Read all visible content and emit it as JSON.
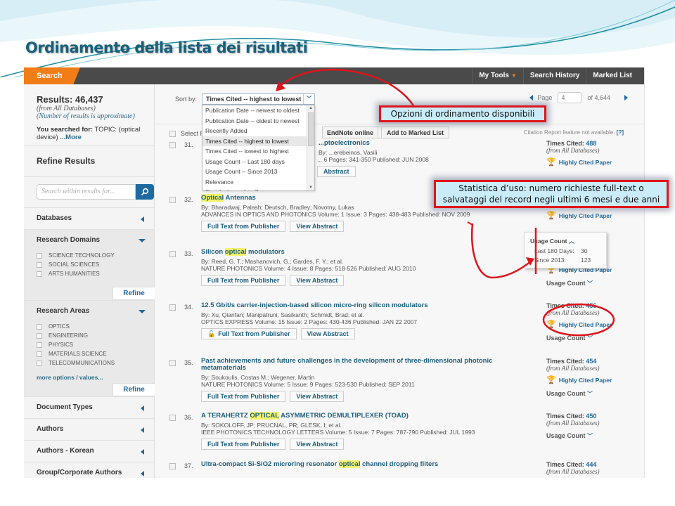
{
  "slide": {
    "title": "Ordinamento della lista dei risultati"
  },
  "colors": {
    "accent_orange": "#f07d17",
    "link_blue": "#1b5e7e",
    "topbar": "#4a4a4a",
    "annotation_red": "#e0141b",
    "callout_bg": "#c9ecf8"
  },
  "topbar": {
    "search_tab": "Search",
    "nav": [
      "My Tools",
      "Search History",
      "Marked List"
    ]
  },
  "left": {
    "results_label": "Results: 46,437",
    "from_db": "(from All Databases)",
    "approx_note": "(Number of results is approximate)",
    "searched_prefix": "You searched for:",
    "searched_query": "TOPIC: (optical device)",
    "more": "...More",
    "refine_title": "Refine Results",
    "search_within_placeholder": "Search within results for...",
    "refine_label": "Refine",
    "more_options": "more options / values...",
    "facets": {
      "databases": "Databases",
      "research_domains": {
        "label": "Research Domains",
        "options": [
          "SCIENCE TECHNOLOGY",
          "SOCIAL SCIENCES",
          "ARTS HUMANITIES"
        ]
      },
      "research_areas": {
        "label": "Research Areas",
        "options": [
          "OPTICS",
          "ENGINEERING",
          "PHYSICS",
          "MATERIALS SCIENCE",
          "TELECOMMUNICATIONS"
        ]
      },
      "document_types": "Document Types",
      "authors": "Authors",
      "authors_korean": "Authors - Korean",
      "group_authors": "Group/Corporate Authors"
    }
  },
  "sort": {
    "label": "Sort by:",
    "selected": "Times Cited -- highest to lowest",
    "options": [
      "Publication Date -- newest to oldest",
      "Publication Date -- oldest to newest",
      "Recently Added",
      "Times Cited -- highest to lowest",
      "Times Cited -- lowest to highest",
      "Usage Count -- Last 180 days",
      "Usage Count -- Since 2013",
      "Relevance",
      "First Author -- A to Z"
    ]
  },
  "pager": {
    "page_label": "Page",
    "current_page": "4",
    "of_label": "of",
    "total_pages": "4,644"
  },
  "toolbar": {
    "select_page": "Select Page",
    "endnote": "EndNote online",
    "add_marked": "Add to Marked List",
    "citation_note": "Citation Report feature not available.",
    "help": "[?]"
  },
  "buttons": {
    "full_text": "Full Text from Publisher",
    "view_abstract": "View Abstract"
  },
  "side_labels": {
    "times_cited": "Times Cited:",
    "from_db": "(from All Databases)",
    "highly_cited": "Highly Cited Paper",
    "usage_count": "Usage Count"
  },
  "usage_popup": {
    "title": "Usage Count",
    "rows": [
      {
        "label": "Last 180 Days:",
        "value": "30"
      },
      {
        "label": "Since 2013:",
        "value": "123"
      }
    ]
  },
  "records": [
    {
      "num": "31.",
      "title_pre": "",
      "title_hl": "",
      "title_post": "...ptoelectronics",
      "authors": "By: ...erebeinos, Vasili",
      "source": "... 6   Pages: 341-350   Published: JUN 2008",
      "times_cited": "488",
      "highly_cited": true
    },
    {
      "num": "32.",
      "title_pre": "",
      "title_hl": "Optical",
      "title_post": " Antennas",
      "authors": "By: Bharadwaj, Palash; Deutsch, Bradley; Novotny, Lukas",
      "source": "ADVANCES IN OPTICS AND PHOTONICS  Volume: 1   Issue: 3   Pages: 438-483   Published: NOV 2009",
      "times_cited": "",
      "highly_cited": true
    },
    {
      "num": "33.",
      "title_pre": "Silicon ",
      "title_hl": "optical",
      "title_post": " modulators",
      "authors": "By: Reed, G. T.; Mashanovich, G.; Gardes, F. Y.; et al.",
      "source": "NATURE PHOTONICS  Volume: 4   Issue: 8   Pages: 518-526   Published: AUG 2010",
      "times_cited": "",
      "highly_cited": true
    },
    {
      "num": "34.",
      "title_pre": "12.5 Gbit/s carrier-injection-based silicon micro-ring silicon modulators",
      "title_hl": "",
      "title_post": "",
      "authors": "By: Xu, Qianfan; Manipatruni, Sasikanth; Schmidt, Brad; et al.",
      "source": "OPTICS EXPRESS  Volume: 15   Issue: 2   Pages: 430-436   Published: JAN 22 2007",
      "times_cited": "456",
      "highly_cited": true,
      "open_access": true
    },
    {
      "num": "35.",
      "title_pre": "Past achievements and future challenges in the development of three-dimensional photonic metamaterials",
      "title_hl": "",
      "title_post": "",
      "authors": "By: Soukoulis, Costas M.; Wegener, Martin",
      "source": "NATURE PHOTONICS  Volume: 5   Issue: 9   Pages: 523-530   Published: SEP 2011",
      "times_cited": "454",
      "highly_cited": true
    },
    {
      "num": "36.",
      "title_pre": "A TERAHERTZ ",
      "title_hl": "OPTICAL",
      "title_post": " ASYMMETRIC DEMULTIPLEXER (TOAD)",
      "authors": "By: SOKOLOFF, JP; PRUCNAL, PR; GLESK, I; et al.",
      "source": "IEEE PHOTONICS TECHNOLOGY LETTERS  Volume: 5   Issue: 7   Pages: 787-790   Published: JUL 1993",
      "times_cited": "450",
      "highly_cited": false
    },
    {
      "num": "37.",
      "title_pre": "Ultra-compact Si-SiO2 microring resonator ",
      "title_hl": "optical",
      "title_post": " channel dropping filters",
      "times_cited": "444"
    }
  ],
  "annotations": {
    "sort_callout": "Opzioni di ordinamento disponibili",
    "usage_callout_line1": "Statistica d’uso: numero richieste full-text o",
    "usage_callout_line2": "salvataggi del record negli ultimi 6 mesi e due anni"
  }
}
